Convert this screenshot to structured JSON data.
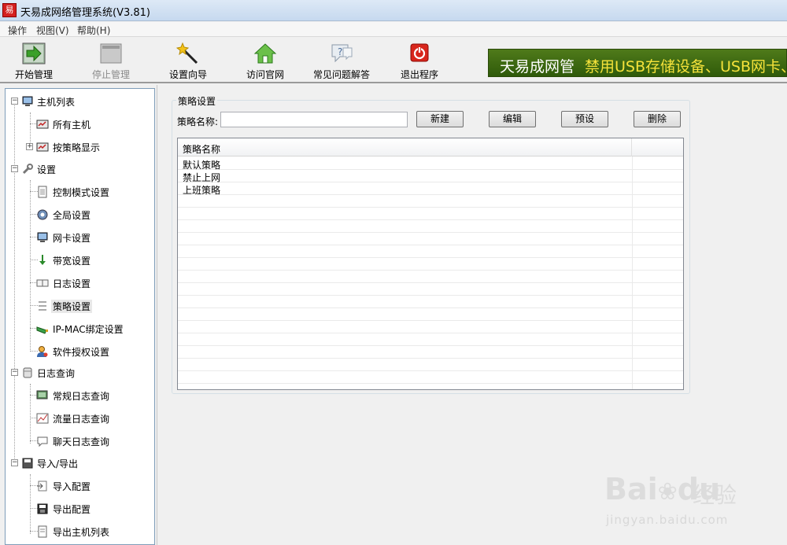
{
  "window": {
    "title": "天易成网络管理系统(V3.81)",
    "app_icon_text": "易"
  },
  "menubar": {
    "items": [
      {
        "label": "操作"
      },
      {
        "label": "视图(V)"
      },
      {
        "label": "帮助(H)"
      }
    ]
  },
  "toolbar": {
    "buttons": [
      {
        "label": "开始管理",
        "icon": "start-arrow-icon",
        "enabled": true
      },
      {
        "label": "停止管理",
        "icon": "stop-square-icon",
        "enabled": false
      },
      {
        "label": "设置向导",
        "icon": "magic-wand-icon",
        "enabled": true
      },
      {
        "label": "访问官网",
        "icon": "home-icon",
        "enabled": true
      },
      {
        "label": "常见问题解答",
        "icon": "faq-bubble-icon",
        "enabled": true
      },
      {
        "label": "退出程序",
        "icon": "power-icon",
        "enabled": true
      }
    ]
  },
  "banner": {
    "brand": "天易成网管",
    "slogan": "禁用USB存储设备、USB网卡、",
    "brand_color": "#ffffff",
    "slogan_color": "#f5e23a"
  },
  "tree": {
    "hosts": {
      "label": "主机列表",
      "children": [
        {
          "label": "所有主机"
        },
        {
          "label": "按策略显示"
        }
      ]
    },
    "settings": {
      "label": "设置",
      "children": [
        {
          "label": "控制模式设置"
        },
        {
          "label": "全局设置"
        },
        {
          "label": "网卡设置"
        },
        {
          "label": "带宽设置"
        },
        {
          "label": "日志设置"
        },
        {
          "label": "策略设置"
        },
        {
          "label": "IP-MAC绑定设置"
        },
        {
          "label": "软件授权设置"
        }
      ]
    },
    "logs": {
      "label": "日志查询",
      "children": [
        {
          "label": "常规日志查询"
        },
        {
          "label": "流量日志查询"
        },
        {
          "label": "聊天日志查询"
        }
      ]
    },
    "io": {
      "label": "导入/导出",
      "children": [
        {
          "label": "导入配置"
        },
        {
          "label": "导出配置"
        },
        {
          "label": "导出主机列表"
        }
      ]
    },
    "selected": "策略设置"
  },
  "policy_panel": {
    "group_title": "策略设置",
    "name_label": "策略名称:",
    "name_value": "",
    "buttons": {
      "new": "新建",
      "edit": "编辑",
      "preset": "预设",
      "delete": "删除"
    },
    "list": {
      "columns": [
        "策略名称",
        ""
      ],
      "rows": [
        "默认策略",
        "禁止上网",
        "上班策略"
      ]
    }
  },
  "watermark": {
    "logo": "Bai",
    "logo2": "du",
    "jingyan": "经验",
    "url": "jingyan.baidu.com"
  }
}
